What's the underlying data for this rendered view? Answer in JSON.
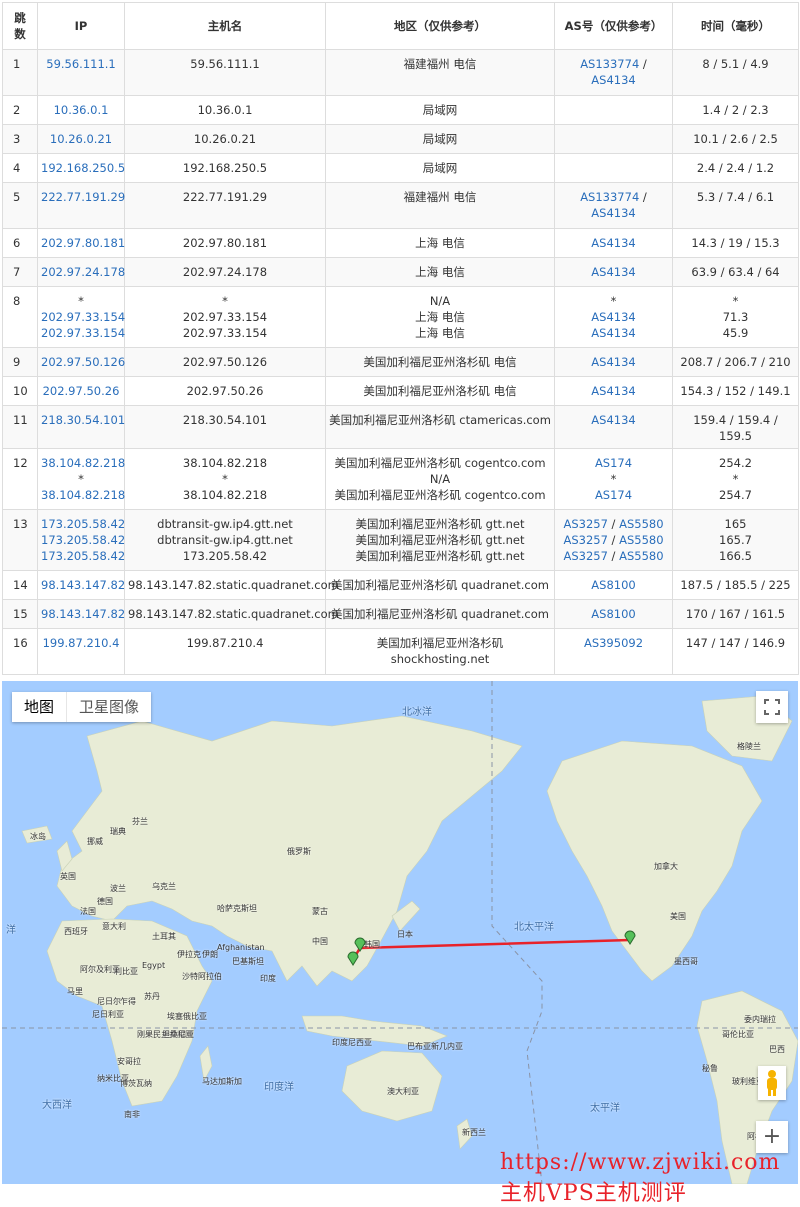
{
  "headers": {
    "hop": "跳数",
    "ip": "IP",
    "host": "主机名",
    "region": "地区（仅供参考）",
    "as": "AS号（仅供参考）",
    "time": "时间（毫秒）"
  },
  "rows": [
    {
      "hop": "1",
      "ip": [
        "59.56.111.1"
      ],
      "host": [
        "59.56.111.1"
      ],
      "region": [
        "福建福州 电信"
      ],
      "as": [
        [
          "AS133774",
          " / "
        ],
        [
          "AS4134"
        ]
      ],
      "time": [
        "8 / 5.1 / 4.9"
      ]
    },
    {
      "hop": "2",
      "ip": [
        "10.36.0.1"
      ],
      "host": [
        "10.36.0.1"
      ],
      "region": [
        "局域网"
      ],
      "as": [],
      "time": [
        "1.4 / 2 / 2.3"
      ]
    },
    {
      "hop": "3",
      "ip": [
        "10.26.0.21"
      ],
      "host": [
        "10.26.0.21"
      ],
      "region": [
        "局域网"
      ],
      "as": [],
      "time": [
        "10.1 / 2.6 / 2.5"
      ]
    },
    {
      "hop": "4",
      "ip": [
        "192.168.250.5"
      ],
      "host": [
        "192.168.250.5"
      ],
      "region": [
        "局域网"
      ],
      "as": [],
      "time": [
        "2.4 / 2.4 / 1.2"
      ]
    },
    {
      "hop": "5",
      "ip": [
        "222.77.191.29"
      ],
      "host": [
        "222.77.191.29"
      ],
      "region": [
        "福建福州 电信"
      ],
      "as": [
        [
          "AS133774",
          " / "
        ],
        [
          "AS4134"
        ]
      ],
      "time": [
        "5.3 / 7.4 / 6.1"
      ]
    },
    {
      "hop": "6",
      "ip": [
        "202.97.80.181"
      ],
      "host": [
        "202.97.80.181"
      ],
      "region": [
        "上海 电信"
      ],
      "as": [
        [
          "AS4134"
        ]
      ],
      "time": [
        "14.3 / 19 / 15.3"
      ]
    },
    {
      "hop": "7",
      "ip": [
        "202.97.24.178"
      ],
      "host": [
        "202.97.24.178"
      ],
      "region": [
        "上海 电信"
      ],
      "as": [
        [
          "AS4134"
        ]
      ],
      "time": [
        "63.9 / 63.4 / 64"
      ]
    },
    {
      "hop": "8",
      "ip": [
        "*",
        "202.97.33.154",
        "202.97.33.154"
      ],
      "host": [
        "*",
        "202.97.33.154",
        "202.97.33.154"
      ],
      "region": [
        "N/A",
        "上海 电信",
        "上海 电信"
      ],
      "as": [
        [
          "*"
        ],
        [
          "AS4134"
        ],
        [
          "AS4134"
        ]
      ],
      "time": [
        "*",
        "71.3",
        "45.9"
      ]
    },
    {
      "hop": "9",
      "ip": [
        "202.97.50.126"
      ],
      "host": [
        "202.97.50.126"
      ],
      "region": [
        "美国加利福尼亚州洛杉矶 电信"
      ],
      "as": [
        [
          "AS4134"
        ]
      ],
      "time": [
        "208.7 / 206.7 / 210"
      ]
    },
    {
      "hop": "10",
      "ip": [
        "202.97.50.26"
      ],
      "host": [
        "202.97.50.26"
      ],
      "region": [
        "美国加利福尼亚州洛杉矶 电信"
      ],
      "as": [
        [
          "AS4134"
        ]
      ],
      "time": [
        "154.3 / 152 / 149.1"
      ]
    },
    {
      "hop": "11",
      "ip": [
        "218.30.54.101"
      ],
      "host": [
        "218.30.54.101"
      ],
      "region": [
        "美国加利福尼亚州洛杉矶 ctamericas.com"
      ],
      "as": [
        [
          "AS4134"
        ]
      ],
      "time": [
        "159.4 / 159.4 / 159.5"
      ]
    },
    {
      "hop": "12",
      "ip": [
        "38.104.82.218",
        "*",
        "38.104.82.218"
      ],
      "host": [
        "38.104.82.218",
        "*",
        "38.104.82.218"
      ],
      "region": [
        "美国加利福尼亚州洛杉矶 cogentco.com",
        "N/A",
        "美国加利福尼亚州洛杉矶 cogentco.com"
      ],
      "as": [
        [
          "AS174"
        ],
        [
          "*"
        ],
        [
          "AS174"
        ]
      ],
      "time": [
        "254.2",
        "*",
        "254.7"
      ]
    },
    {
      "hop": "13",
      "ip": [
        "173.205.58.42",
        "173.205.58.42",
        "173.205.58.42"
      ],
      "host": [
        "dbtransit-gw.ip4.gtt.net",
        "dbtransit-gw.ip4.gtt.net",
        "173.205.58.42"
      ],
      "region": [
        "美国加利福尼亚州洛杉矶 gtt.net",
        "美国加利福尼亚州洛杉矶 gtt.net",
        "美国加利福尼亚州洛杉矶 gtt.net"
      ],
      "as": [
        [
          "AS3257",
          " / ",
          "AS5580"
        ],
        [
          "AS3257",
          " / ",
          "AS5580"
        ],
        [
          "AS3257",
          " / ",
          "AS5580"
        ]
      ],
      "time": [
        "165",
        "165.7",
        "166.5"
      ]
    },
    {
      "hop": "14",
      "ip": [
        "98.143.147.82"
      ],
      "host": [
        "98.143.147.82.static.quadranet.com"
      ],
      "region": [
        "美国加利福尼亚州洛杉矶 quadranet.com"
      ],
      "as": [
        [
          "AS8100"
        ]
      ],
      "time": [
        "187.5 / 185.5 / 225"
      ]
    },
    {
      "hop": "15",
      "ip": [
        "98.143.147.82"
      ],
      "host": [
        "98.143.147.82.static.quadranet.com"
      ],
      "region": [
        "美国加利福尼亚州洛杉矶 quadranet.com"
      ],
      "as": [
        [
          "AS8100"
        ]
      ],
      "time": [
        "170 / 167 / 161.5"
      ]
    },
    {
      "hop": "16",
      "ip": [
        "199.87.210.4"
      ],
      "host": [
        "199.87.210.4"
      ],
      "region": [
        "美国加利福尼亚州洛杉矶",
        "shockhosting.net"
      ],
      "as": [
        [
          "AS395092"
        ]
      ],
      "time": [
        "147 / 147 / 146.9"
      ]
    }
  ],
  "map": {
    "tab_map": "地图",
    "tab_satellite": "卫星图像",
    "colors": {
      "water": "#a3ccff",
      "land": "#e8ecd6",
      "route": "#e8222a",
      "marker": "#56c05a"
    },
    "labels": [
      {
        "t": "北冰洋"
      },
      {
        "t": "冰岛"
      },
      {
        "t": "芬兰"
      },
      {
        "t": "瑞典"
      },
      {
        "t": "挪威"
      },
      {
        "t": "俄罗斯"
      },
      {
        "t": "英国"
      },
      {
        "t": "波兰"
      },
      {
        "t": "乌克兰"
      },
      {
        "t": "德国"
      },
      {
        "t": "法国"
      },
      {
        "t": "意大利"
      },
      {
        "t": "西班牙"
      },
      {
        "t": "土耳其"
      },
      {
        "t": "哈萨克斯坦"
      },
      {
        "t": "蒙古"
      },
      {
        "t": "中国"
      },
      {
        "t": "韩国"
      },
      {
        "t": "日本"
      },
      {
        "t": "伊拉克"
      },
      {
        "t": "伊朗"
      },
      {
        "t": "Afghanistan"
      },
      {
        "t": "巴基斯坦"
      },
      {
        "t": "印度"
      },
      {
        "t": "沙特阿拉伯"
      },
      {
        "t": "Egypt"
      },
      {
        "t": "阿尔及利亚"
      },
      {
        "t": "利比亚"
      },
      {
        "t": "马里"
      },
      {
        "t": "尼日尔"
      },
      {
        "t": "乍得"
      },
      {
        "t": "苏丹"
      },
      {
        "t": "尼日利亚"
      },
      {
        "t": "埃塞俄比亚"
      },
      {
        "t": "刚果民主共和国"
      },
      {
        "t": "坦桑尼亚"
      },
      {
        "t": "安哥拉"
      },
      {
        "t": "纳米比亚"
      },
      {
        "t": "博茨瓦纳"
      },
      {
        "t": "南非"
      },
      {
        "t": "马达加斯加"
      },
      {
        "t": "印度洋"
      },
      {
        "t": "大西洋"
      },
      {
        "t": "印度尼西亚"
      },
      {
        "t": "巴布亚新几内亚"
      },
      {
        "t": "澳大利亚"
      },
      {
        "t": "新西兰"
      },
      {
        "t": "北太平洋"
      },
      {
        "t": "太平洋"
      },
      {
        "t": "加拿大"
      },
      {
        "t": "美国"
      },
      {
        "t": "墨西哥"
      },
      {
        "t": "委内瑞拉"
      },
      {
        "t": "哥伦比亚"
      },
      {
        "t": "巴西"
      },
      {
        "t": "秘鲁"
      },
      {
        "t": "玻利维亚"
      },
      {
        "t": "阿根廷"
      },
      {
        "t": "格陵兰"
      },
      {
        "t": "洋"
      }
    ]
  },
  "watermark": "https://www.zjwiki.com  主机VPS主机测评"
}
